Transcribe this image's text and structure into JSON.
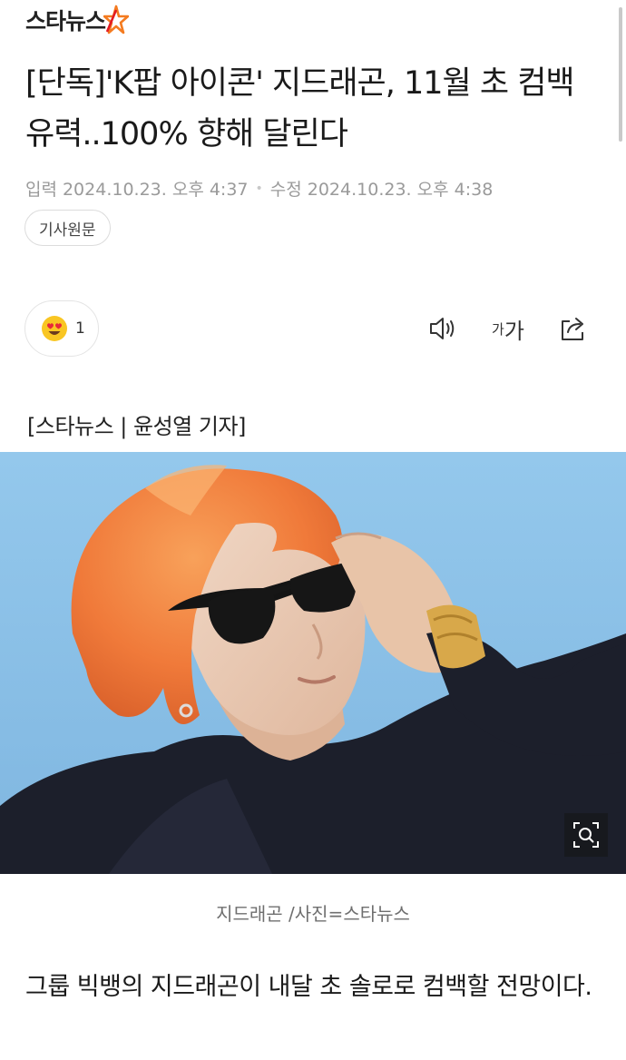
{
  "header": {
    "logo_text": "스타뉴스"
  },
  "article": {
    "title": "[단독]'K팝 아이콘' 지드래곤, 11월 초 컴백 유력..100% 향해 달린다",
    "input_label": "입력",
    "input_time": "2024.10.23. 오후 4:37",
    "modify_label": "수정",
    "modify_time": "2024.10.23. 오후 4:38",
    "original_button": "기사원문",
    "byline": "[스타뉴스 | 윤성열 기자]",
    "photo_caption": "지드래곤 /사진=스타뉴스",
    "body": "그룹 빅뱅의 지드래곤이 내달 초 솔로로 컴백할 전망이다."
  },
  "reaction": {
    "icon": "heart-eyes-emoji-icon",
    "count": "1"
  },
  "toolbar": {
    "tts_icon": "speaker-icon",
    "font_size_small": "가",
    "font_size_large": "가",
    "share_icon": "share-icon"
  },
  "colors": {
    "logo_accent_orange": "#f47b20",
    "logo_accent_red": "#e31b23",
    "photo_background": "#8fc3e8",
    "hair": "#f07a3a"
  }
}
